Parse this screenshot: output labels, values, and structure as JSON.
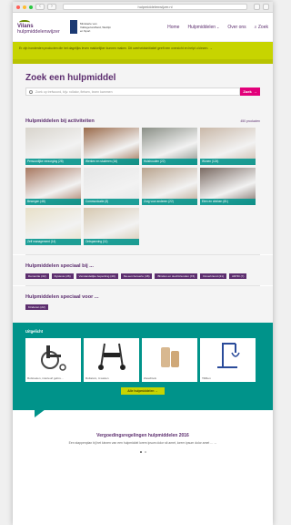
{
  "browser": {
    "url": "hulpmiddelenwijzer.nl",
    "colors": {
      "close": "#ff5f57",
      "min": "#febc2e",
      "max": "#28c840"
    }
  },
  "header": {
    "logo_line1": "Vilans",
    "logo_line2": "hulpmiddelenwijzer",
    "gov_text": "Ministerie van Volksgezondheid, Welzijn en Sport",
    "nav": [
      {
        "label": "Home"
      },
      {
        "label": "Hulpmiddelen",
        "chev": "⌄"
      },
      {
        "label": "Over ons"
      },
      {
        "label": "Zoek",
        "icon": "search-icon"
      }
    ]
  },
  "notice": {
    "text": "Er zijn honderden producten die het dagelijks leven makkelijker kunnen maken. Dit overheidsinitiatief geeft een overzicht en helpt u kiezen. →"
  },
  "search": {
    "title": "Zoek een hulpmiddel",
    "placeholder": "Zoek op trefwoord, bijv. rollator, fietsen, lezen kammen",
    "button": "Zoek",
    "button_arrow": "→"
  },
  "activities": {
    "title": "Hulpmiddelen bij activiteiten",
    "count": "450 producten",
    "tiles": [
      {
        "label": "Persoonlijke verzorging (28)",
        "bg": "#d8d4cc"
      },
      {
        "label": "Werken en studeren (16)",
        "bg": "#9a6a4a"
      },
      {
        "label": "Huishouden (22)",
        "bg": "#8a8f86"
      },
      {
        "label": "Wonen (124)",
        "bg": "#c9b8a8"
      },
      {
        "label": "Bewegen (48)",
        "bg": "#a87860"
      },
      {
        "label": "Communicatie (8)",
        "bg": "#e6e6e6"
      },
      {
        "label": "Zorg voor anderen (22)",
        "bg": "#b9a48e"
      },
      {
        "label": "Eten en drinken (81)",
        "bg": "#7a6a62"
      },
      {
        "label": "Zelf management (14)",
        "bg": "#e8e0c8"
      },
      {
        "label": "Ontspanning (11)",
        "bg": "#d6c8b0"
      }
    ]
  },
  "special": {
    "title": "Hulpmiddelen speciaal bij ...",
    "tags": [
      "Dementie (32)",
      "Dyslexie (26)",
      "Verstandelijke beperking (40)",
      "Na een beroerte (48)",
      "Blinden en slechtzienden (73)",
      "Doveriziend (21)",
      "ADHD (7)"
    ]
  },
  "special_for": {
    "title": "Hulpmiddelen speciaal voor ...",
    "tags": [
      "Kinderen (22)"
    ]
  },
  "featured": {
    "title": "Uitgelicht",
    "products": [
      {
        "name": "Rolstoelen, interieurl gebru...",
        "icon": "wheelchair-icon"
      },
      {
        "name": "Rollators, 4-wielen",
        "icon": "rollator-icon"
      },
      {
        "name": "Zwachtels",
        "icon": "bandage-icon"
      },
      {
        "name": "Tilliften",
        "icon": "patient-lift-icon"
      }
    ],
    "button": "Alle hulpmiddelen →"
  },
  "regulations": {
    "title": "Vergoedingsregelingen hulpmiddelen 2016",
    "text": "Een stappenplan bij het kiezen van een hulpmiddel lorem ipsum dolor sit amet, lorem ipsum dolor amet ... →"
  }
}
